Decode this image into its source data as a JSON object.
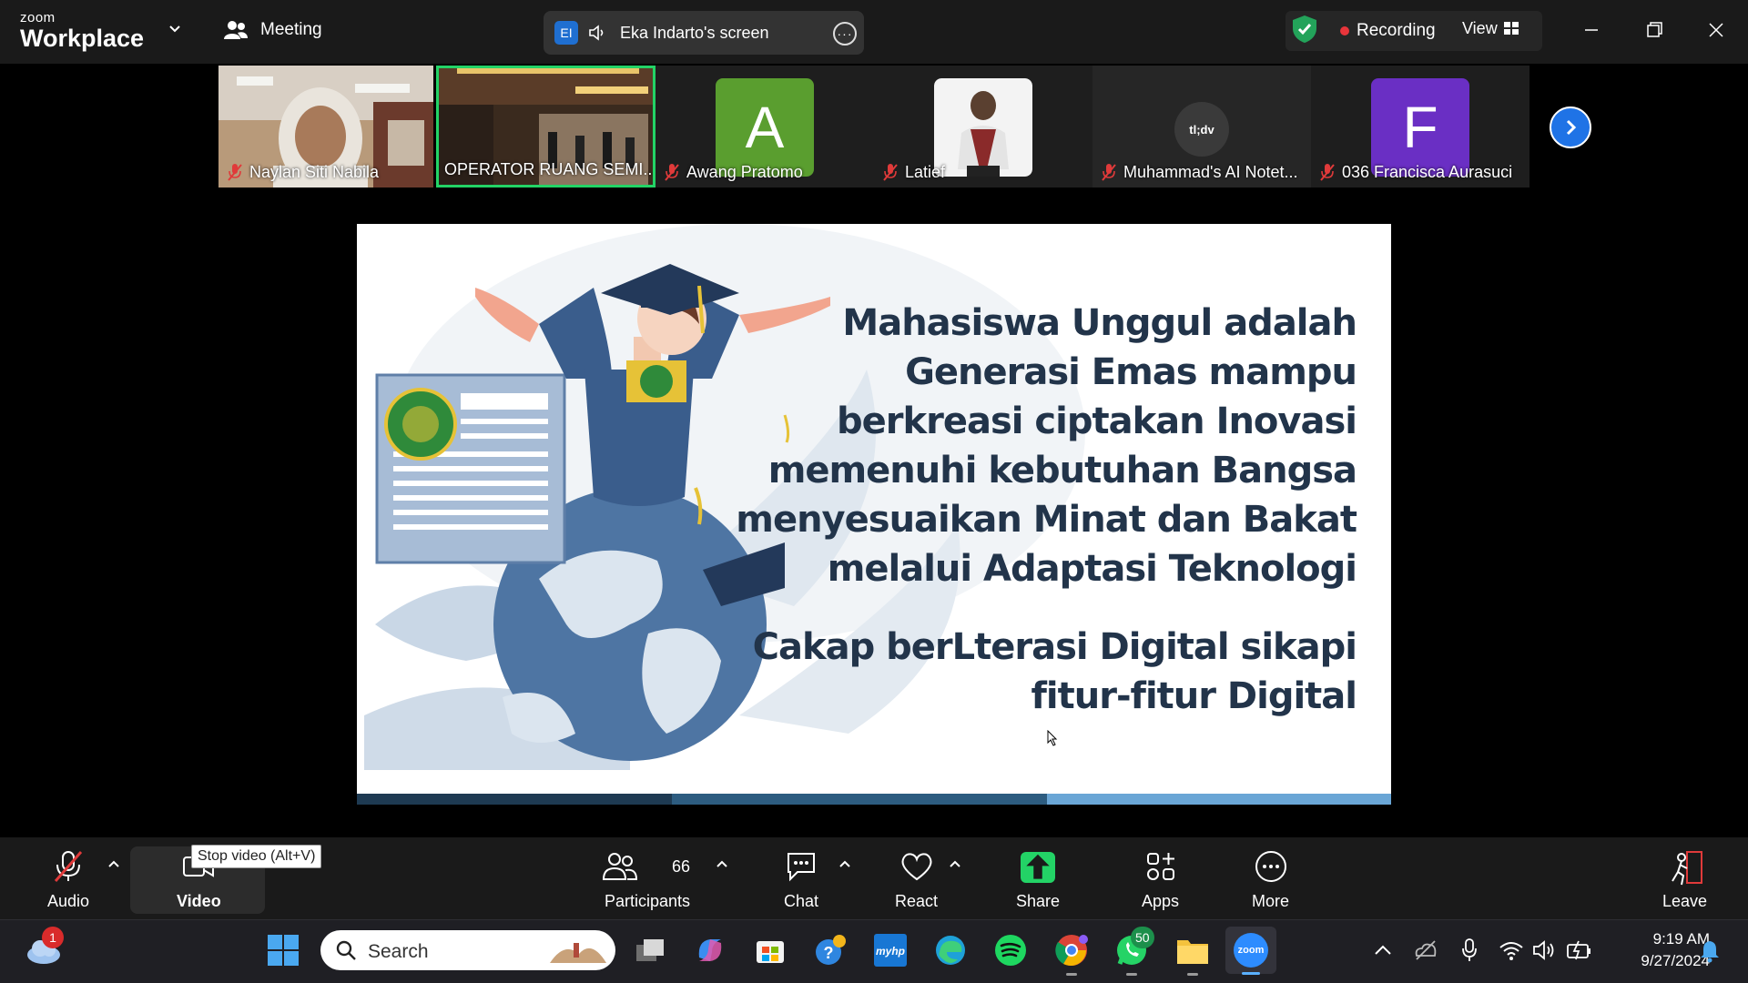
{
  "window": {
    "brand_small": "zoom",
    "brand_big": "Workplace",
    "meeting_label": "Meeting",
    "share_badge": "EI",
    "shared_screen_label": "Eka Indarto's screen",
    "recording_label": "Recording",
    "view_label": "View"
  },
  "participants": [
    {
      "name": "Naylan Siti Nabila",
      "type": "video",
      "mic_muted": true
    },
    {
      "name": "OPERATOR RUANG SEMI...",
      "type": "video",
      "mic_muted": false,
      "active_speaker": true
    },
    {
      "name": "Awang Pratomo",
      "type": "avatar",
      "initial": "A",
      "color": "#5a9e2f",
      "mic_muted": true
    },
    {
      "name": "Latief",
      "type": "photo",
      "mic_muted": true
    },
    {
      "name": "Muhammad's AI Notet...",
      "type": "logo",
      "logo_text": "tl;dv",
      "mic_muted": true
    },
    {
      "name": "036 Francisca Aurasuci",
      "type": "avatar",
      "initial": "F",
      "color": "#6a2fc4",
      "mic_muted": true
    }
  ],
  "slide": {
    "lines": [
      "Mahasiswa Unggul adalah",
      "Generasi Emas mampu",
      "berkreasi ciptakan Inovasi",
      "memenuhi kebutuhan Bangsa",
      "menyesuaikan Minat dan Bakat",
      "melalui Adaptasi Teknologi"
    ],
    "lines2": [
      "Cakap berLterasi Digital sikapi",
      "fitur-fitur Digital"
    ],
    "bar_colors": [
      "#1e3a52",
      "#2d5c80",
      "#6aa6d6"
    ]
  },
  "controls": {
    "audio": "Audio",
    "video": "Video",
    "video_tooltip": "Stop video (Alt+V)",
    "participants": "Participants",
    "participant_count": "66",
    "chat": "Chat",
    "react": "React",
    "share": "Share",
    "apps": "Apps",
    "more": "More",
    "leave": "Leave"
  },
  "taskbar": {
    "search_placeholder": "Search",
    "weather_badge": "1",
    "whatsapp_badge": "50",
    "zoom_label": "zoom",
    "time": "9:19 AM",
    "date": "9/27/2024"
  },
  "colors": {
    "accent_green": "#23d366",
    "recording_red": "#e8353b",
    "slide_text": "#22344a"
  }
}
